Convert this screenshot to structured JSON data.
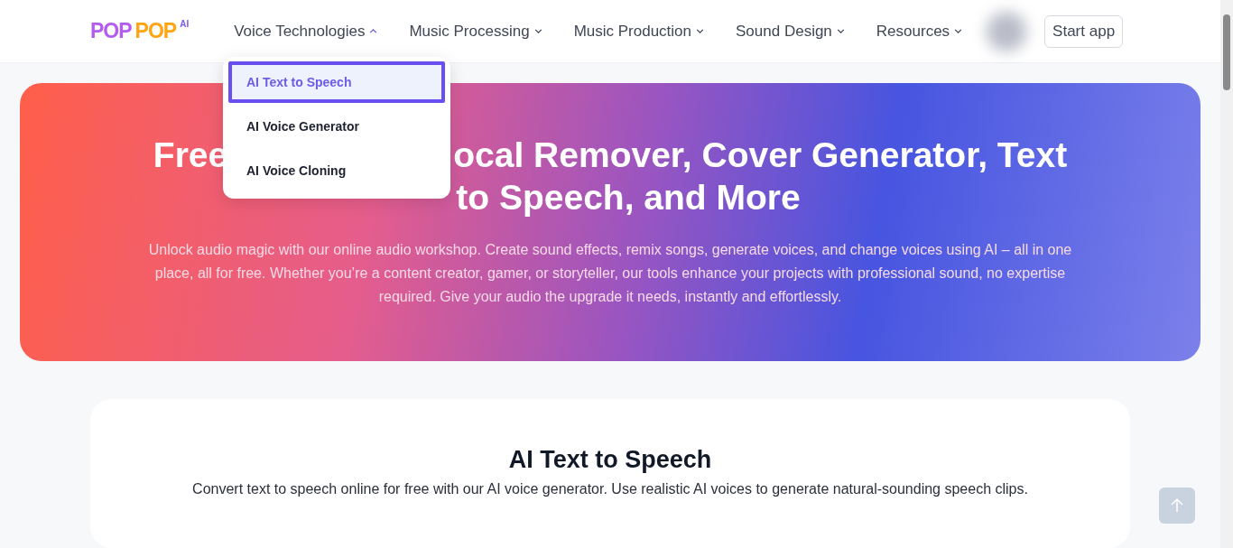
{
  "header": {
    "logo": {
      "word_1": "POP",
      "word_2": "POP",
      "suffix": "AI"
    },
    "nav": [
      {
        "label": "Voice Technologies",
        "expanded": true
      },
      {
        "label": "Music Processing",
        "expanded": false
      },
      {
        "label": "Music Production",
        "expanded": false
      },
      {
        "label": "Sound Design",
        "expanded": false
      },
      {
        "label": "Resources",
        "expanded": false
      }
    ],
    "start_button": "Start app"
  },
  "dropdown": {
    "items": [
      {
        "label": "AI Text to Speech",
        "selected": true
      },
      {
        "label": "AI Voice Generator",
        "selected": false
      },
      {
        "label": "AI Voice Cloning",
        "selected": false
      }
    ]
  },
  "hero": {
    "title_parts": [
      "Free",
      "ocal Remover, Cover Generator, Text",
      "to Speech, and More"
    ],
    "text": "Unlock audio magic with our online audio workshop. Create sound effects, remix songs, generate voices, and change voices using AI – all in one place, all for free. Whether you’re a content creator, gamer, or storyteller, our tools enhance your projects with professional sound, no expertise required. Give your audio the upgrade it needs, instantly and effortlessly."
  },
  "section": {
    "title": "AI Text to Speech",
    "text": "Convert text to speech online for free with our AI voice generator. Use realistic AI voices to generate natural-sounding speech clips."
  }
}
